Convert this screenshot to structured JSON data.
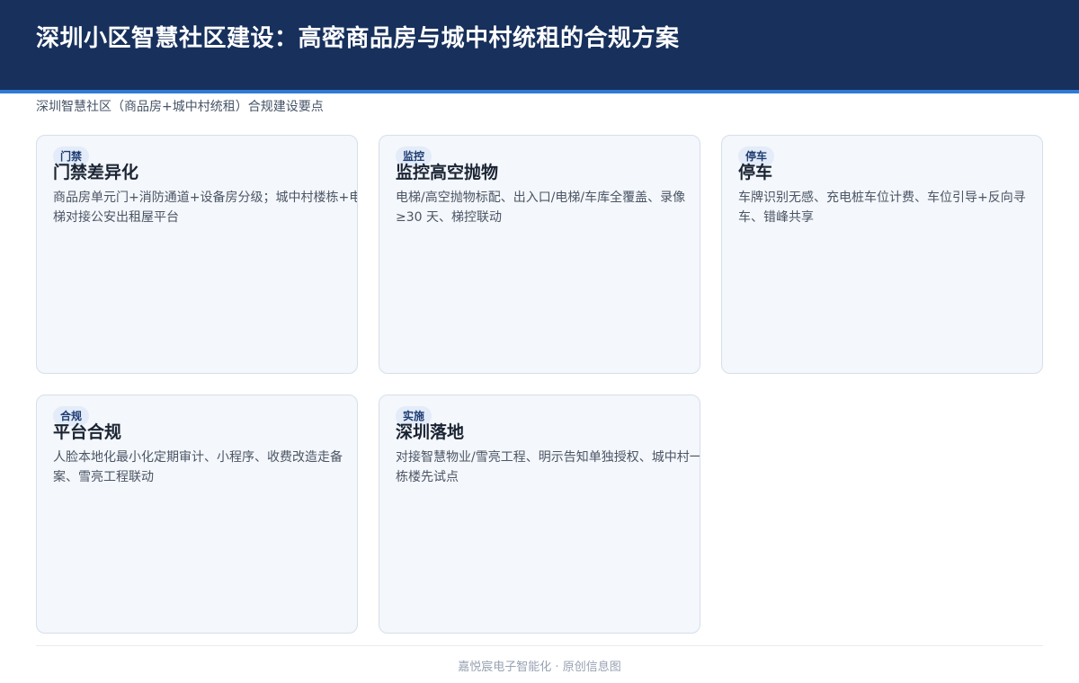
{
  "header": {
    "title": "深圳小区智慧社区建设：高密商品房与城中村统租的合规方案"
  },
  "subtitle": "深圳智慧社区（商品房+城中村统租）合规建设要点",
  "cards": [
    {
      "tag": "门禁",
      "title": "门禁差异化",
      "desc": "商品房单元门+消防通道+设备房分级；城中村楼栋+电梯对接公安出租屋平台"
    },
    {
      "tag": "监控",
      "title": "监控高空抛物",
      "desc": "电梯/高空抛物标配、出入口/电梯/车库全覆盖、录像≥30 天、梯控联动"
    },
    {
      "tag": "停车",
      "title": "停车",
      "desc": "车牌识别无感、充电桩车位计费、车位引导+反向寻车、错峰共享"
    },
    {
      "tag": "合规",
      "title": "平台合规",
      "desc": "人脸本地化最小化定期审计、小程序、收费改造走备案、雪亮工程联动"
    },
    {
      "tag": "实施",
      "title": "深圳落地",
      "desc": "对接智慧物业/雪亮工程、明示告知单独授权、城中村一栋楼先试点"
    }
  ],
  "footer": "嘉悦宸电子智能化 · 原创信息图"
}
